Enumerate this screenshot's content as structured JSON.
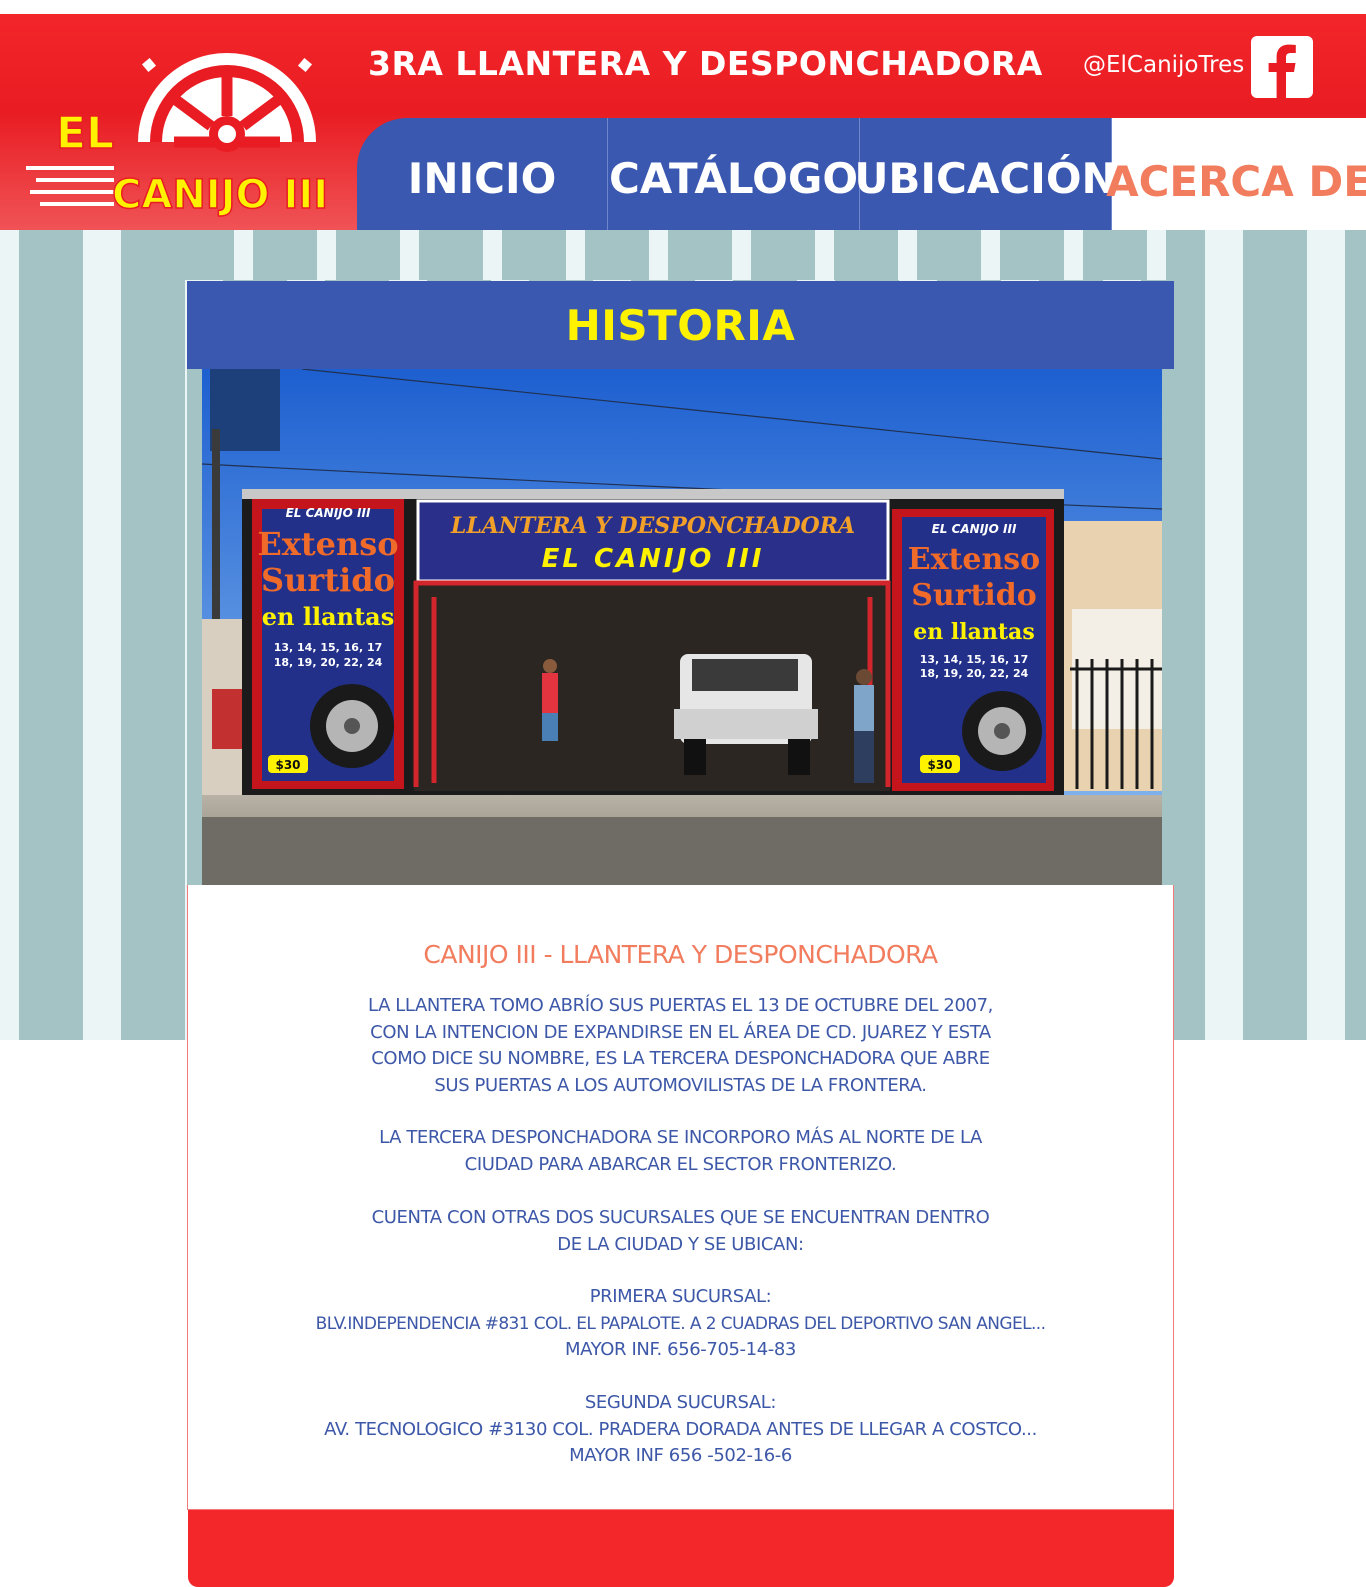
{
  "header": {
    "logo": {
      "line1": "EL",
      "line2": "CANIJO III"
    },
    "tagline": "3RA LLANTERA Y DESPONCHADORA",
    "facebook_handle": "@ElCanijoTres",
    "facebook_icon": "facebook-icon"
  },
  "nav": {
    "items": [
      {
        "label": "INICIO"
      },
      {
        "label": "CATÁLOGO"
      },
      {
        "label": "UBICACIÓN"
      },
      {
        "label": "ACERCA DE",
        "active": true
      }
    ]
  },
  "section": {
    "title": "HISTORIA"
  },
  "photo": {
    "banner_top_line1": "LLANTERA Y DESPONCHADORA",
    "banner_top_line2": "EL CANIJO III",
    "sign_left": {
      "brand": "EL CANIJO III",
      "line1": "Extenso",
      "line2": "Surtido",
      "line3": "en llantas",
      "sizes1": "13, 14, 15, 16, 17",
      "sizes2": "18, 19, 20, 22, 24",
      "price": "$30"
    },
    "sign_right": {
      "brand": "EL CANIJO III",
      "line1": "Extenso",
      "line2": "Surtido",
      "line3": "en llantas",
      "sizes1": "13, 14, 15, 16, 17",
      "sizes2": "18, 19, 20, 22, 24",
      "price": "$30"
    }
  },
  "content": {
    "heading": "CANIJO III - LLANTERA Y DESPONCHADORA",
    "paragraphs": [
      [
        "LA LLANTERA TOMO ABRÍO SUS PUERTAS EL 13 DE OCTUBRE DEL 2007,",
        "CON LA INTENCION DE EXPANDIRSE EN EL ÁREA DE CD. JUAREZ Y ESTA",
        "COMO DICE SU NOMBRE, ES LA TERCERA DESPONCHADORA QUE ABRE",
        "SUS PUERTAS A LOS AUTOMOVILISTAS DE LA FRONTERA."
      ],
      [
        "LA TERCERA DESPONCHADORA SE INCORPORO MÁS AL NORTE DE LA",
        "CIUDAD PARA ABARCAR EL SECTOR FRONTERIZO."
      ],
      [
        "CUENTA CON OTRAS DOS SUCURSALES QUE SE ENCUENTRAN DENTRO",
        "DE LA CIUDAD Y SE UBICAN:"
      ],
      [
        "PRIMERA SUCURSAL:",
        "BLV.INDEPENDENCIA #831 COL. EL PAPALOTE. A 2 CUADRAS DEL DEPORTIVO SAN ANGEL...",
        "MAYOR INF. 656-705-14-83"
      ],
      [
        "SEGUNDA SUCURSAL:",
        "AV. TECNOLOGICO #3130 COL. PRADERA DORADA ANTES DE LLEGAR A COSTCO...",
        "MAYOR INF 656 -502-16-6"
      ]
    ]
  },
  "colors": {
    "brand_red": "#f3262a",
    "nav_blue": "#3a58b0",
    "title_yellow": "#fff200",
    "accent_orange": "#f27c5e",
    "text_blue": "#3d58a8",
    "stripe_teal": "#a3c3c4"
  }
}
